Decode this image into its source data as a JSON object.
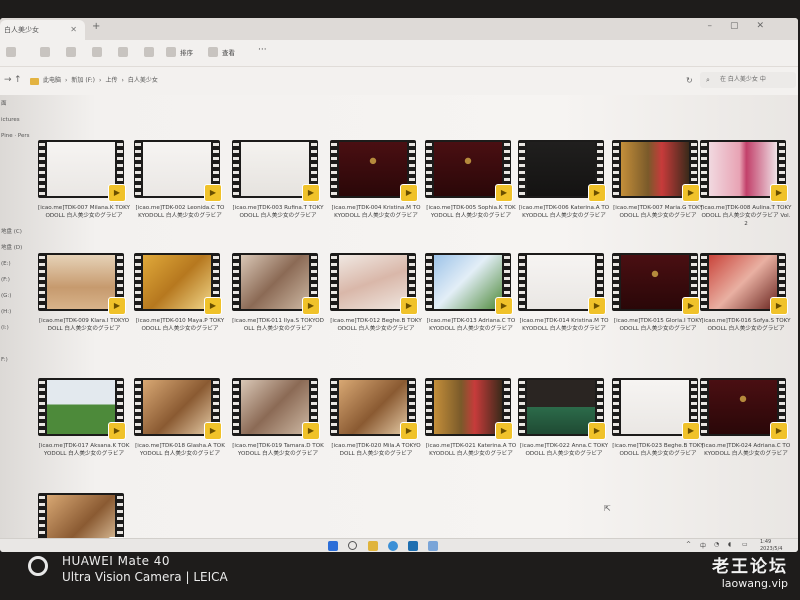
{
  "window": {
    "tab_title": "白人美少女",
    "new_tab": "+"
  },
  "toolbar": {
    "sort_label": "排序",
    "view_label": "查看",
    "more_label": "···"
  },
  "address": {
    "crumbs": [
      "此电脑",
      "新加 (F:)",
      "上传",
      "白人美少女"
    ],
    "search_placeholder": "在 白人美少女 中"
  },
  "sidebar": {
    "items": [
      "面",
      "ictures",
      "Pine · Pers",
      "",
      "",
      "",
      "",
      "",
      "地盘 (C)",
      "地盘 (D)",
      "(E:)",
      "(F:)",
      "(G:)",
      "(H:)",
      "(I:)",
      "",
      "F:)"
    ]
  },
  "files": [
    {
      "name": "[icao.me]TDK-007 Milana.K TOKYODOLL 白人美少女のグラビア",
      "thumb": "white"
    },
    {
      "name": "[icao.me]TDK-002 Leonida.C TOKYODOLL 白人美少女のグラビア",
      "thumb": "white"
    },
    {
      "name": "[icao.me]TDK-003 Rufina.T TOKYODOLL 白人美少女のグラビア",
      "thumb": "logo"
    },
    {
      "name": "[icao.me]TDK-004 Kristina.M TOKYODOLL 白人美少女のグラビア",
      "thumb": "curtain"
    },
    {
      "name": "[icao.me]TDK-005 Sophia.K TOKYODOLL 白人美少女のグラビア",
      "thumb": "curtain"
    },
    {
      "name": "[icao.me]TDK-006 Katerina.A TOKYODOLL 白人美少女のグラビア",
      "thumb": "dark"
    },
    {
      "name": "[icao.me]TDK-007 Maria.G TOKYODOLL 白人美少女のグラビア",
      "thumb": "room"
    },
    {
      "name": "[icao.me]TDK-008 Aulina.T TOKYODOLL 白人美少女のグラビア Vol.2",
      "thumb": "pink"
    },
    {
      "name": "[icao.me]TDK-009 Klara.I TOKYODOLL 白人美少女のグラビア",
      "thumb": "beach"
    },
    {
      "name": "[icao.me]TDK-010 Maya.P TOKYODOLL 白人美少女のグラビア",
      "thumb": "gold"
    },
    {
      "name": "[icao.me]TDK-011 Ilya.S TOKYODOLL 白人美少女のグラビア",
      "thumb": "bed"
    },
    {
      "name": "[icao.me]TDK-012 Beghe.B TOKYODOLL 白人美少女のグラビア",
      "thumb": "legs"
    },
    {
      "name": "[icao.me]TDK-013 Adriana.C TOKYODOLL 白人美少女のグラビア",
      "thumb": "outdoor"
    },
    {
      "name": "[icao.me]TDK-014 Kristina.M TOKYODOLL 白人美少女のグラビア",
      "thumb": "white"
    },
    {
      "name": "[icao.me]TDK-015 Gloria.I TOKYODOLL 白人美少女のグラビア",
      "thumb": "curtain"
    },
    {
      "name": "[icao.me]TDK-016 Sofya.S TOKYODOLL 白人美少女のグラビア",
      "thumb": "red"
    },
    {
      "name": "[icao.me]TDK-017 Aksana.K TOKYODOLL 白人美少女のグラビア",
      "thumb": "field"
    },
    {
      "name": "[icao.me]TDK-018 Glasha.A TOKYODOLL 白人美少女のグラビア",
      "thumb": "warm"
    },
    {
      "name": "[icao.me]TDK-019 Tamara.D TOKYODOLL 白人美少女のグラビア",
      "thumb": "bed"
    },
    {
      "name": "[icao.me]TDK-020 Mila.A TOKYODOLL 白人美少女のグラビア",
      "thumb": "warm"
    },
    {
      "name": "[icao.me]TDK-021 Katerina.A TOKYODOLL 白人美少女のグラビア",
      "thumb": "room"
    },
    {
      "name": "[icao.me]TDK-022 Anna.C TOKYODOLL 白人美少女のグラビア",
      "thumb": "pool"
    },
    {
      "name": "[icao.me]TDK-023 Beghe.B TOKYODOLL 白人美少女のグラビア",
      "thumb": "white"
    },
    {
      "name": "[icao.me]TDK-024 Adriana.C TOKYODOLL 白人美少女のグラビア",
      "thumb": "curtain"
    },
    {
      "name": "",
      "thumb": "warm"
    }
  ],
  "taskbar": {
    "lang": "中",
    "time": "1:49",
    "date": "2023/5/4"
  },
  "photo_overlay": {
    "device": "HUAWEI Mate 40",
    "camera": "Ultra Vision Camera | LEICA",
    "site_name": "老王论坛",
    "site_url": "laowang.vip"
  },
  "colors": {
    "badge": "#f0c22a",
    "folder": "#e3b341",
    "film": "#1c1b1a"
  }
}
